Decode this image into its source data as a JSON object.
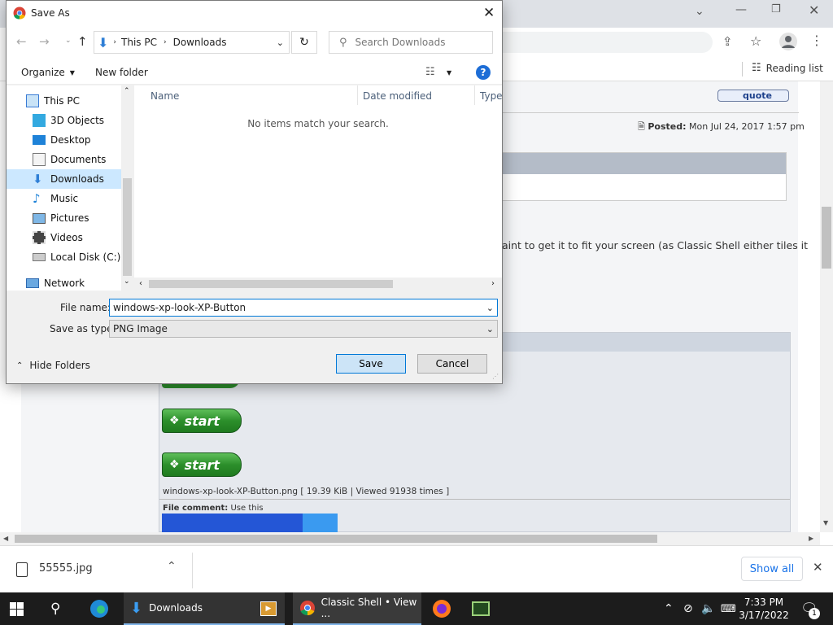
{
  "dialog": {
    "title": "Save As",
    "breadcrumb": [
      "This PC",
      "Downloads"
    ],
    "search_placeholder": "Search Downloads",
    "organize_label": "Organize",
    "new_folder_label": "New folder",
    "tree": [
      {
        "label": "This PC",
        "icon": "pc-icon"
      },
      {
        "label": "3D Objects",
        "icon": "cube-icon"
      },
      {
        "label": "Desktop",
        "icon": "desktop-icon"
      },
      {
        "label": "Documents",
        "icon": "document-icon"
      },
      {
        "label": "Downloads",
        "icon": "download-icon",
        "selected": true
      },
      {
        "label": "Music",
        "icon": "music-icon"
      },
      {
        "label": "Pictures",
        "icon": "pictures-icon"
      },
      {
        "label": "Videos",
        "icon": "video-icon"
      },
      {
        "label": "Local Disk (C:)",
        "icon": "disk-icon"
      },
      {
        "label": "Network",
        "icon": "network-icon"
      }
    ],
    "columns": [
      "Name",
      "Date modified",
      "Type"
    ],
    "empty_message": "No items match your search.",
    "file_name_label": "File name:",
    "file_name_value": "windows-xp-look-XP-Button",
    "save_type_label": "Save as type:",
    "save_type_value": "PNG Image",
    "hide_folders_label": "Hide Folders",
    "save_label": "Save",
    "cancel_label": "Cancel"
  },
  "browser": {
    "reading_list_label": "Reading list",
    "quote_label": "quote",
    "posted_label": "Posted:",
    "posted_date": "Mon Jul 24, 2017 1:57 pm",
    "post_text_fragment": "aint to get it to fit your screen (as Classic Shell either tiles it",
    "start_label": "start",
    "attachment_caption": "windows-xp-look-XP-Button.png [ 19.39 KiB | Viewed 91938 times ]",
    "file_comment_label": "File comment:",
    "file_comment_value": "Use this",
    "download_file": "55555.jpg",
    "show_all_label": "Show all"
  },
  "taskbar": {
    "downloads_label": "Downloads",
    "chrome_label": "Classic Shell • View ...",
    "time": "7:33 PM",
    "date": "3/17/2022",
    "notification_count": "1"
  },
  "colors": {
    "accent": "#0078d7",
    "selected": "#cce8ff",
    "xp_green": "#2c8f2b"
  }
}
